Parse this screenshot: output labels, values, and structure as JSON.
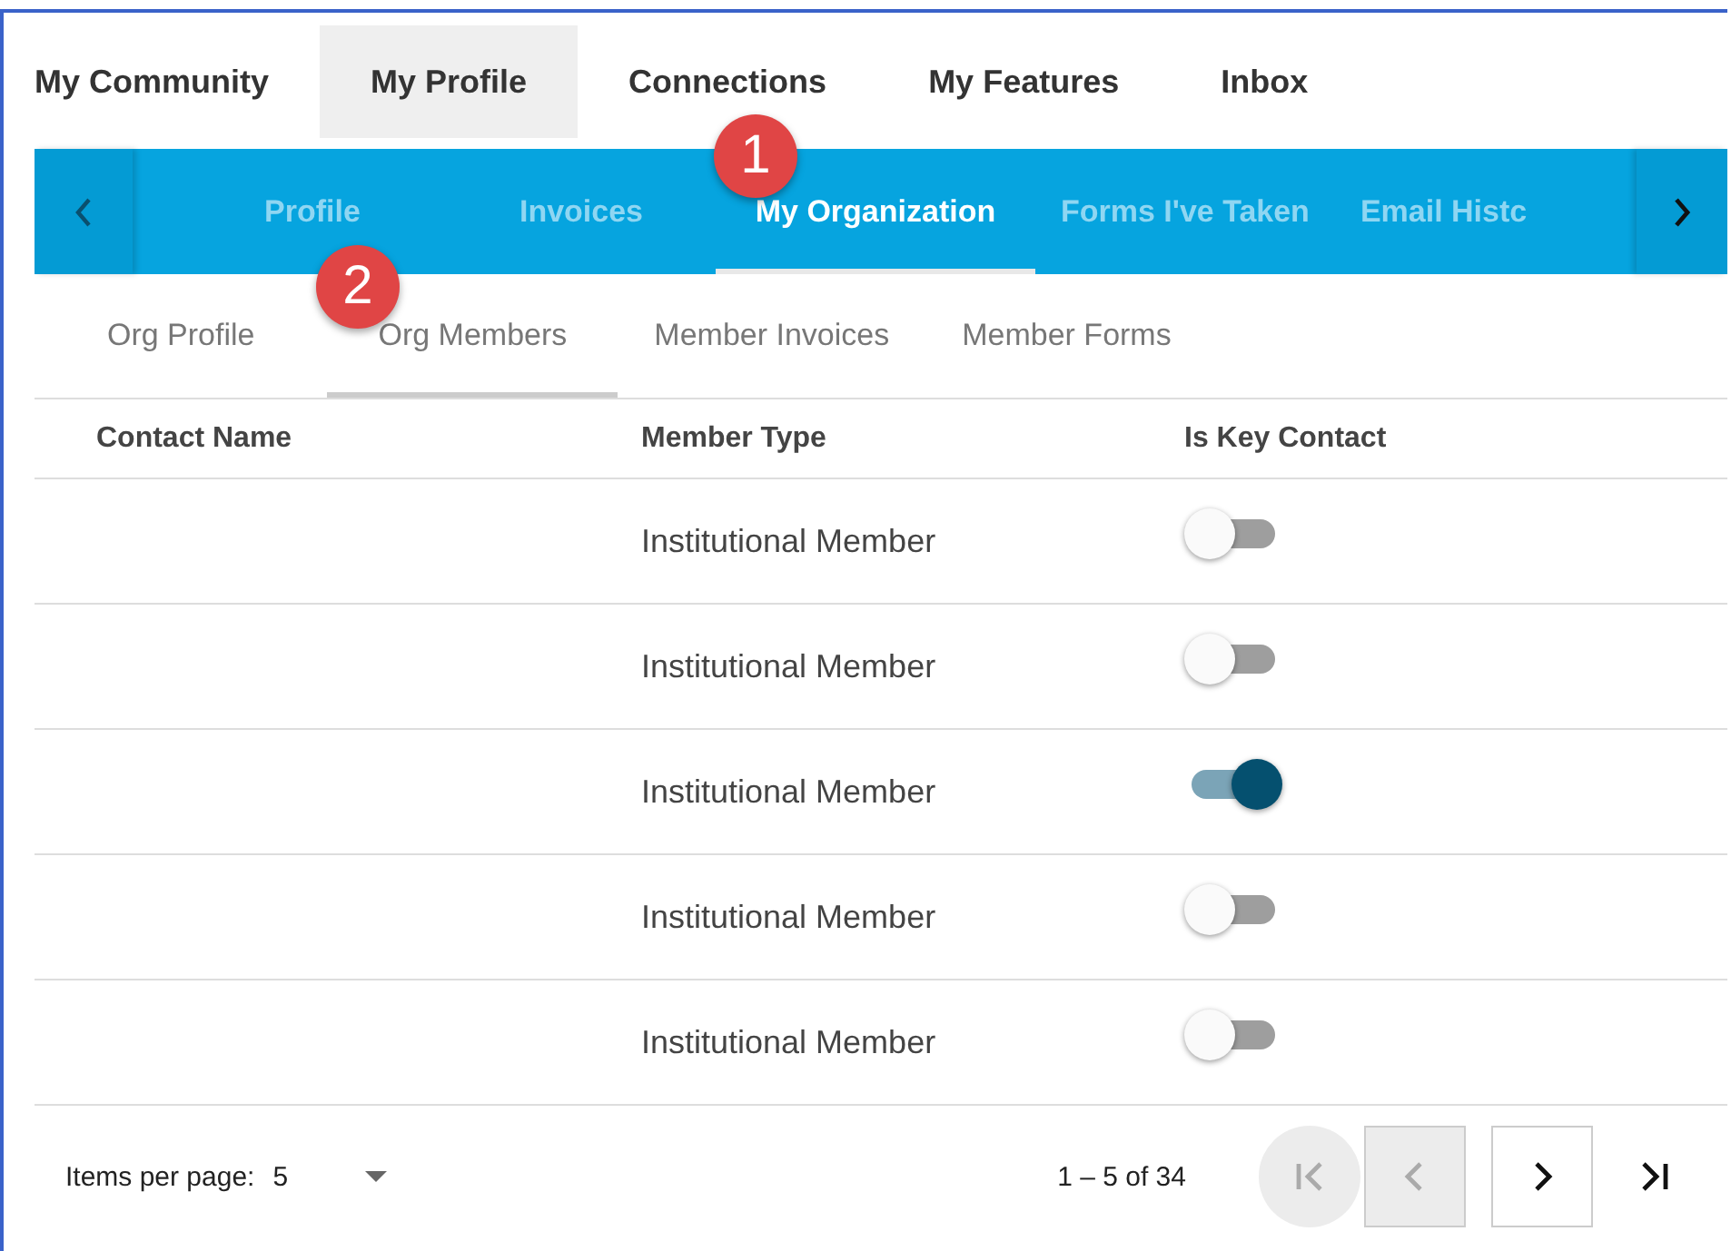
{
  "top_nav": [
    {
      "label": "My Community",
      "selected": false
    },
    {
      "label": "My Profile",
      "selected": true
    },
    {
      "label": "Connections",
      "selected": false
    },
    {
      "label": "My Features",
      "selected": false
    },
    {
      "label": "Inbox",
      "selected": false
    }
  ],
  "section_tabs": [
    {
      "label": "Profile",
      "selected": false
    },
    {
      "label": "Invoices",
      "selected": false
    },
    {
      "label": "My Organization",
      "selected": true
    },
    {
      "label": "Forms I've Taken",
      "selected": false
    },
    {
      "label": "Email Histc",
      "selected": false
    }
  ],
  "sub_tabs": [
    {
      "label": "Org Profile",
      "selected": false
    },
    {
      "label": "Org Members",
      "selected": true
    },
    {
      "label": "Member Invoices",
      "selected": false
    },
    {
      "label": "Member Forms",
      "selected": false
    }
  ],
  "callouts": [
    "1",
    "2"
  ],
  "table": {
    "columns": [
      "Contact Name",
      "Member Type",
      "Is Key Contact"
    ],
    "rows": [
      {
        "member_type": "Institutional Member",
        "key_contact": false
      },
      {
        "member_type": "Institutional Member",
        "key_contact": false
      },
      {
        "member_type": "Institutional Member",
        "key_contact": true
      },
      {
        "member_type": "Institutional Member",
        "key_contact": false
      },
      {
        "member_type": "Institutional Member",
        "key_contact": false
      }
    ]
  },
  "paginator": {
    "label": "Items per page:",
    "page_size": "5",
    "range": "1 – 5 of 34",
    "buttons": [
      {
        "kind": "first",
        "disabled": true
      },
      {
        "kind": "prev",
        "disabled": true
      },
      {
        "kind": "next",
        "disabled": false
      },
      {
        "kind": "last",
        "disabled": false
      }
    ]
  }
}
